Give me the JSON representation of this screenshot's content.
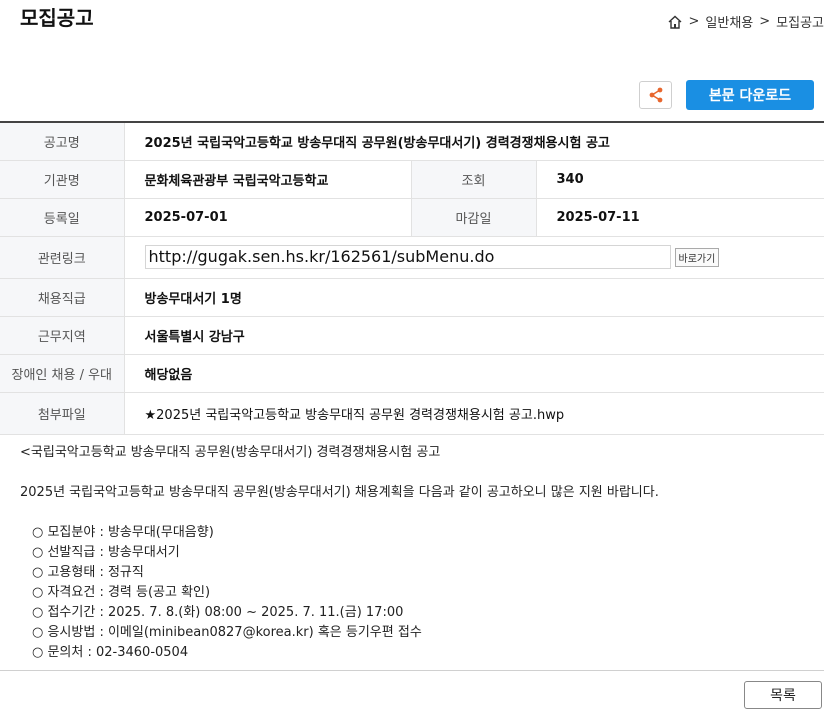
{
  "page_title": "모집공고",
  "breadcrumb": {
    "sep1": ">",
    "item1": "일반채용",
    "sep2": ">",
    "item2": "모집공고"
  },
  "toolbar": {
    "download_label": "본문 다운로드"
  },
  "details": {
    "title_label": "공고명",
    "title_value": "2025년 국립국악고등학교 방송무대직 공무원(방송무대서기) 경력경쟁채용시험 공고",
    "org_label": "기관명",
    "org_value": "문화체육관광부 국립국악고등학교",
    "views_label": "조회",
    "views_value": "340",
    "reg_label": "등록일",
    "reg_value": "2025-07-01",
    "deadline_label": "마감일",
    "deadline_value": "2025-07-11",
    "link_label": "관련링크",
    "link_value": "http://gugak.sen.hs.kr/162561/subMenu.do",
    "link_go": "바로가기",
    "position_label": "채용직급",
    "position_value": "방송무대서기 1명",
    "region_label": "근무지역",
    "region_value": "서울특별시 강남구",
    "disability_label": "장애인 채용 / 우대",
    "disability_value": "해당없음",
    "file_label": "첨부파일",
    "file_value": "★2025년 국립국악고등학교 방송무대직 공무원 경력경쟁채용시험 공고.hwp"
  },
  "body": {
    "heading": "<국립국악고등학교 방송무대직 공무원(방송무대서기) 경력경쟁채용시험 공고",
    "intro": "2025년 국립국악고등학교 방송무대직 공무원(방송무대서기) 채용계획을 다음과 같이 공고하오니 많은 지원 바랍니다.",
    "items": [
      "○ 모집분야 : 방송무대(무대음향)",
      "○ 선발직급 : 방송무대서기",
      "○ 고용형태 : 정규직",
      "○ 자격요건 : 경력 등(공고 확인)",
      "○ 접수기간 : 2025. 7. 8.(화) 08:00 ~ 2025. 7. 11.(금) 17:00",
      "○ 응시방법 : 이메일(minibean0827@korea.kr) 혹은 등기우편 접수",
      "○ 문의처 : 02-3460-0504"
    ]
  },
  "footer": {
    "list_label": "목록"
  }
}
